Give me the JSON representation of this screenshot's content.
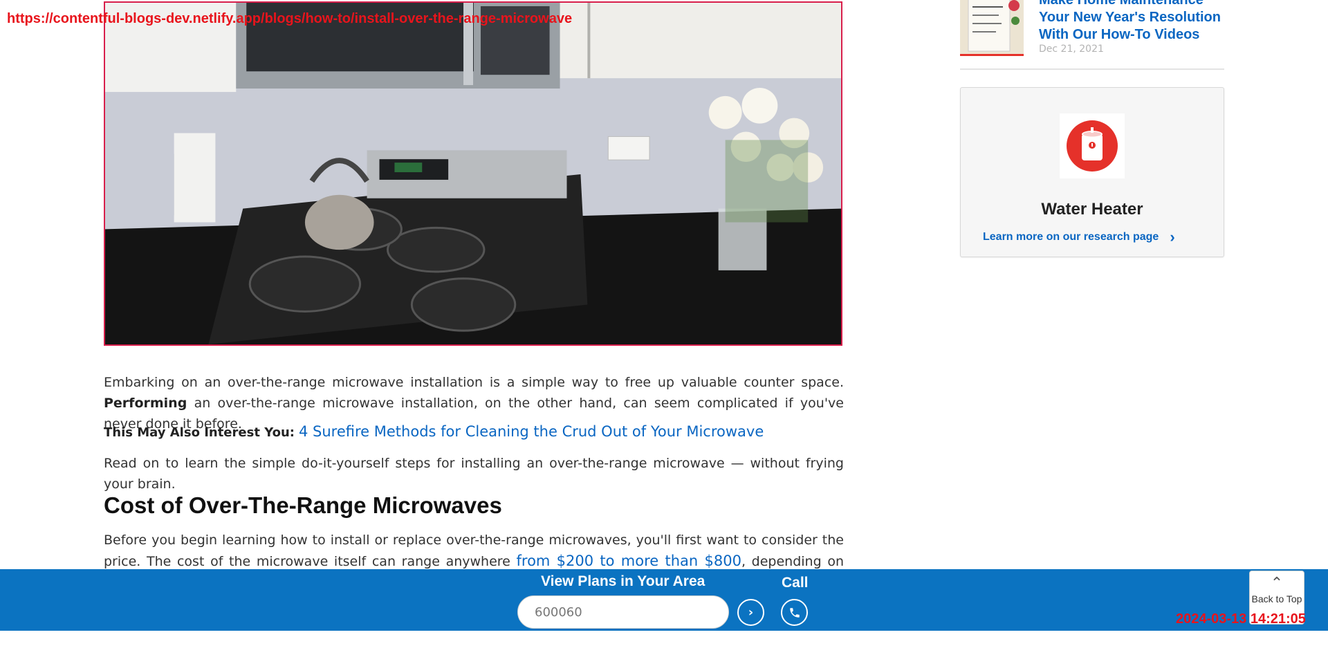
{
  "overlay": {
    "url": "https://contentful-blogs-dev.netlify.app/blogs/how-to/install-over-the-range-microwave",
    "timestamp": "2024-03-13 14:21:05"
  },
  "hero": {
    "alt": "Over-the-range microwave above a gas stove in a kitchen"
  },
  "article": {
    "p1_start": "Embarking on an over-the-range microwave installation is a simple way to free up valuable counter space. ",
    "p1_bold": "Performing",
    "p1_end": " an over-the-range microwave installation, on the other hand, can seem complicated if you've never done it before.",
    "interest_label": "This May Also Interest You:",
    "interest_link": "4 Surefire Methods for Cleaning the Crud Out of Your Microwave",
    "p3": "Read on to learn the simple do-it-yourself steps for installing an over-the-range microwave — without frying your brain.",
    "h2": "Cost of Over-The-Range Microwaves",
    "p4_start": "Before you begin learning how to install or replace over-the-range microwaves, you'll first want to consider the price. The cost of the microwave itself can range anywhere ",
    "p4_link": "from $200 to more than $800",
    "p4_end": ", depending on which brand,"
  },
  "sidebar": {
    "related": {
      "title": "Make Home Maintenance Your New Year's Resolution With Our How-To Videos",
      "date": "Dec 21, 2021"
    },
    "card": {
      "title": "Water Heater",
      "link": "Learn more on our research page",
      "icon": "water-heater-icon",
      "accent": "#e5312a"
    }
  },
  "bottom_bar": {
    "title": "View Plans in Your Area",
    "zip_value": "600060",
    "call_label": "Call",
    "back_to_top": "Back to Top",
    "bg_color": "#0b73c1"
  }
}
